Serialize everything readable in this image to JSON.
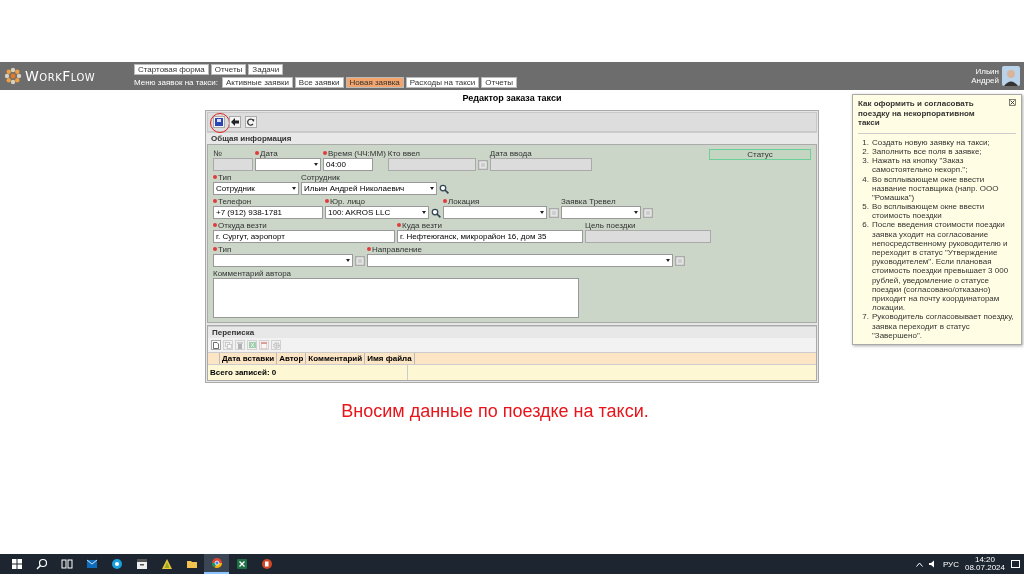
{
  "header": {
    "logo": "WorkFlow",
    "top_menu": [
      {
        "label": "Стартовая форма"
      },
      {
        "label": "Отчеты"
      },
      {
        "label": "Задачи"
      }
    ],
    "submenu_label": "Меню заявок на такси:",
    "tabs": [
      {
        "label": "Активные заявки",
        "selected": false
      },
      {
        "label": "Все заявки",
        "selected": false
      },
      {
        "label": "Новая заявка",
        "selected": true
      },
      {
        "label": "Расходы на такси",
        "selected": false
      },
      {
        "label": "Отчеты",
        "selected": false
      }
    ],
    "user": [
      "Ильин",
      "Андрей"
    ]
  },
  "title": "Редактор заказа такси",
  "toolbar": [
    {
      "kind": "save",
      "highlighted": true
    },
    {
      "kind": "back",
      "highlighted": false
    },
    {
      "kind": "refresh",
      "highlighted": false
    }
  ],
  "form": {
    "section": "Общая информация",
    "status": "Статус",
    "rows": [
      {
        "fields": [
          {
            "label": "№",
            "required": false,
            "kind": "readonly"
          },
          {
            "label": "Дата",
            "required": true,
            "kind": "select"
          },
          {
            "label": "Время (ЧЧ:ММ)",
            "required": true,
            "kind": "text",
            "value": "04:00"
          },
          {
            "label": "Кто ввел",
            "required": false,
            "kind": "readonly",
            "lookup_button": true
          },
          {
            "label": "Дата ввода",
            "required": false,
            "kind": "readonly"
          }
        ]
      },
      {
        "fields": [
          {
            "label": "Тип",
            "required": true,
            "kind": "select",
            "value": "Сотрудник"
          },
          {
            "label": "Сотрудник",
            "required": false,
            "kind": "select",
            "value": "Ильин Андрей Николаевич",
            "search_button": true
          }
        ]
      },
      {
        "fields": [
          {
            "label": "Телефон",
            "required": true,
            "kind": "text",
            "value": "+7 (912) 938-1781"
          },
          {
            "label": "Юр. лицо",
            "required": true,
            "kind": "select",
            "value": "100: AKROS LLC",
            "search_button": true
          },
          {
            "label": "Локация",
            "required": true,
            "kind": "select",
            "lookup_button": true
          },
          {
            "label": "Заявка Тревел",
            "required": false,
            "kind": "select",
            "lookup_button": true
          }
        ]
      },
      {
        "fields": [
          {
            "label": "Откуда везти",
            "required": true,
            "kind": "text",
            "value": "г. Сургут, аэропорт"
          },
          {
            "label": "Куда везти",
            "required": true,
            "kind": "text",
            "value": "г. Нефтеюганск, микрорайон 16, дом 35"
          },
          {
            "label": "Цель поездки",
            "required": false,
            "kind": "readonly"
          }
        ]
      },
      {
        "fields": [
          {
            "label": "Тип",
            "required": true,
            "kind": "select",
            "lookup_button": true
          },
          {
            "label": "Направление",
            "required": true,
            "kind": "select",
            "lookup_button": true
          }
        ]
      },
      {
        "fields": [
          {
            "label": "Комментарий автора",
            "required": false,
            "kind": "textarea"
          }
        ]
      }
    ]
  },
  "correspondence": {
    "section": "Переписка",
    "tools": [
      {
        "kind": "new",
        "disabled": false
      },
      {
        "kind": "copy",
        "disabled": true
      },
      {
        "kind": "delete",
        "disabled": true
      },
      {
        "kind": "excel",
        "disabled": true
      },
      {
        "kind": "pdf",
        "disabled": true
      },
      {
        "kind": "settings",
        "disabled": true
      }
    ],
    "columns": [
      "Дата вставки",
      "Автор",
      "Комментарий",
      "Имя файла"
    ],
    "footer": "Всего записей: 0"
  },
  "caption": "Вносим данные по поездке на такси.",
  "help": {
    "title": "Как оформить и согласовать поездку на некорпоративном такси",
    "steps": [
      {
        "number": "1.",
        "text": "Создать новую заявку на такси;"
      },
      {
        "number": "2.",
        "text": "Заполнить все поля в заявке;"
      },
      {
        "number": "3.",
        "text": "Нажать на кнопку \"Заказ самостоятельно некорп.\";"
      },
      {
        "number": "4.",
        "text": "Во всплывающем окне ввести название поставщика (напр. ООО \"Ромашка\")"
      },
      {
        "number": "5.",
        "text": "Во всплывающем окне ввести стоимость поездки"
      },
      {
        "number": "6.",
        "text": "После введения стоимости поездки заявка уходит на согласование непосредственному руководителю и переходит в статус \"Утверждение руководителем\". Если плановая стоимость поездки превышает 3 000 рублей, уведомление о статусе поездки (согласовано/отказано) приходит на почту координаторам локации."
      },
      {
        "number": "7.",
        "text": "Руководитель согласовывает поездку, заявка переходит в статус \"Завершено\"."
      }
    ]
  },
  "taskbar": {
    "apps": [
      {
        "kind": "start",
        "selected": false
      },
      {
        "kind": "search",
        "selected": false
      },
      {
        "kind": "taskview",
        "selected": false
      },
      {
        "kind": "mail",
        "selected": false
      },
      {
        "kind": "chat",
        "selected": false
      },
      {
        "kind": "archive",
        "selected": false
      },
      {
        "kind": "triangle",
        "selected": false
      },
      {
        "kind": "folder",
        "selected": false
      },
      {
        "kind": "browser",
        "selected": true
      },
      {
        "kind": "sheet",
        "selected": false
      },
      {
        "kind": "slides",
        "selected": false
      }
    ],
    "language": "РУС",
    "time": "14:20",
    "date": "08.07.2024"
  }
}
